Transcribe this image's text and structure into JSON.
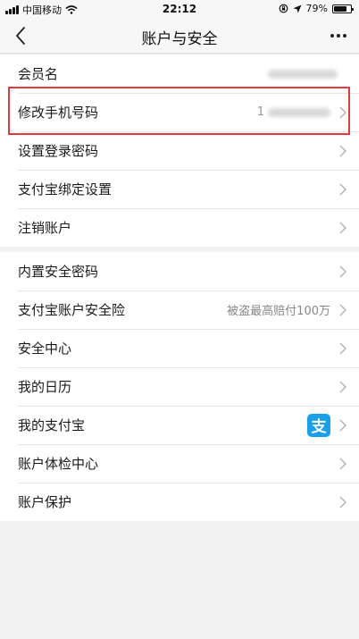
{
  "status_bar": {
    "carrier": "中国移动",
    "time": "22:12",
    "battery_text": "79%",
    "battery_level": 0.79
  },
  "nav": {
    "title": "账户与安全"
  },
  "group1": [
    {
      "label": "会员名",
      "value_hidden": true
    },
    {
      "label": "修改手机号码",
      "value_prefix": "1",
      "value_hidden": true
    },
    {
      "label": "设置登录密码"
    },
    {
      "label": "支付宝绑定设置"
    },
    {
      "label": "注销账户"
    }
  ],
  "group2": [
    {
      "label": "内置安全密码"
    },
    {
      "label": "支付宝账户安全险",
      "value": "被盗最高赔付100万"
    },
    {
      "label": "安全中心"
    },
    {
      "label": "我的日历"
    },
    {
      "label": "我的支付宝",
      "icon": "alipay-icon",
      "icon_glyph": "支"
    },
    {
      "label": "账户体检中心"
    },
    {
      "label": "账户保护"
    }
  ],
  "colors": {
    "highlight": "#e23b3b",
    "alipay": "#1aa0e8"
  }
}
